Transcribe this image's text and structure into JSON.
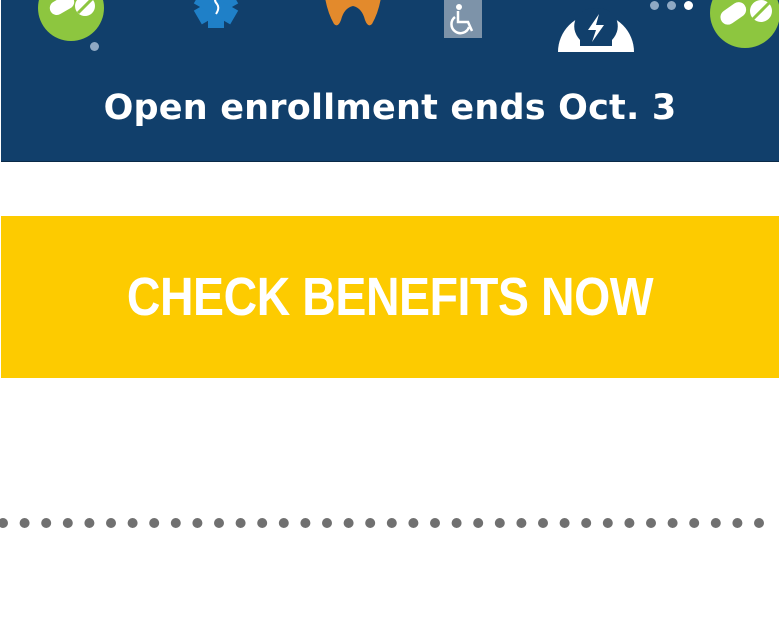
{
  "banner": {
    "title": "Open enrollment ends Oct. 3",
    "background": "#113f6b",
    "icons": [
      "pill-icon",
      "star-of-life-icon",
      "tooth-icon",
      "wheelchair-icon",
      "lightbulb-icon",
      "pill-icon"
    ]
  },
  "cta": {
    "label": "CHECK BENEFITS NOW",
    "background": "#fdcb00",
    "text_color": "#ffffff"
  },
  "divider": {
    "style": "dotted",
    "color": "#707070"
  }
}
